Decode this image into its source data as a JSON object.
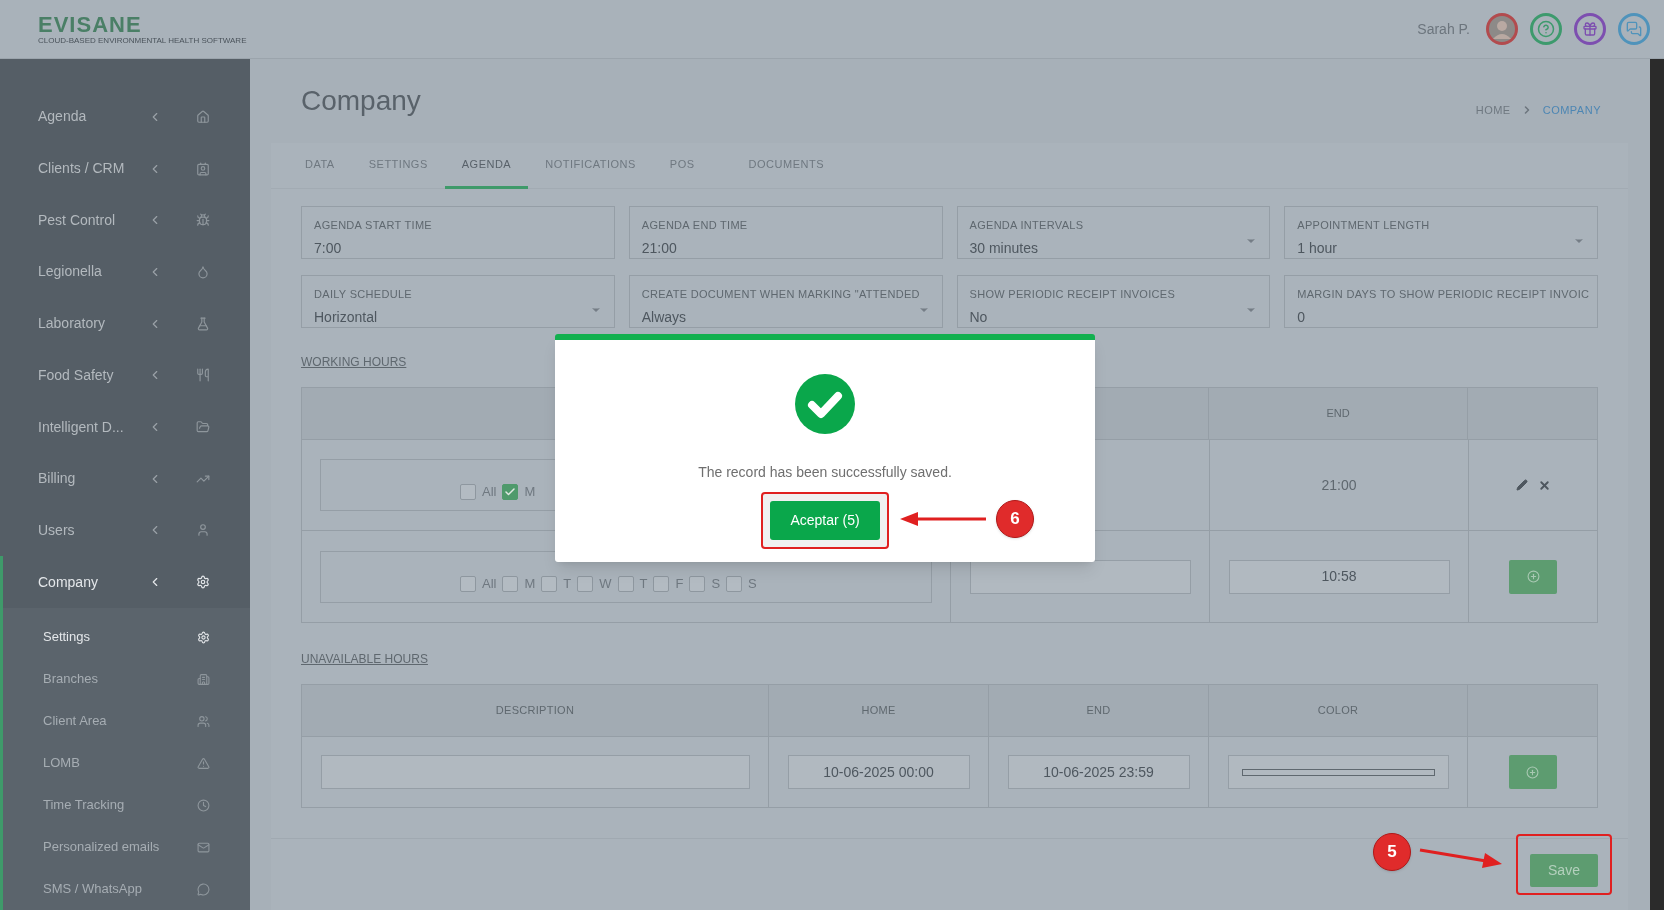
{
  "header": {
    "logo_name": "EVISANE",
    "logo_tagline": "CLOUD-BASED ENVIRONMENTAL HEALTH SOFTWARE",
    "user_name": "Sarah P."
  },
  "sidebar": {
    "items": [
      {
        "label": "Agenda",
        "selected": false
      },
      {
        "label": "Clients / CRM",
        "selected": false
      },
      {
        "label": "Pest Control",
        "selected": false
      },
      {
        "label": "Legionella",
        "selected": false
      },
      {
        "label": "Laboratory",
        "selected": false
      },
      {
        "label": "Food Safety",
        "selected": false
      },
      {
        "label": "Intelligent D...",
        "selected": false
      },
      {
        "label": "Billing",
        "selected": false
      },
      {
        "label": "Users",
        "selected": false
      },
      {
        "label": "Company",
        "selected": true,
        "expanded": true,
        "children": [
          {
            "label": "Settings",
            "selected": true
          },
          {
            "label": "Branches",
            "selected": false
          },
          {
            "label": "Client Area",
            "selected": false
          },
          {
            "label": "LOMB",
            "selected": false
          },
          {
            "label": "Time Tracking",
            "selected": false
          },
          {
            "label": "Personalized emails",
            "selected": false
          },
          {
            "label": "SMS / WhatsApp",
            "selected": false
          }
        ]
      }
    ]
  },
  "page": {
    "title": "Company",
    "breadcrumb": [
      {
        "label": "HOME",
        "selected": false
      },
      {
        "label": "COMPANY",
        "selected": true
      }
    ]
  },
  "tabs": [
    {
      "label": "DATA",
      "selected": false
    },
    {
      "label": "SETTINGS",
      "selected": false
    },
    {
      "label": "AGENDA",
      "selected": true
    },
    {
      "label": "NOTIFICATIONS",
      "selected": false
    },
    {
      "label": "POS",
      "selected": false
    },
    {
      "label": "DOCUMENTS",
      "selected": false
    }
  ],
  "fields": [
    {
      "label": "AGENDA START TIME",
      "value": "7:00",
      "kind": "text"
    },
    {
      "label": "AGENDA END TIME",
      "value": "21:00",
      "kind": "text"
    },
    {
      "label": "AGENDA INTERVALS",
      "value": "30 minutes",
      "kind": "select"
    },
    {
      "label": "APPOINTMENT LENGTH",
      "value": "1 hour",
      "kind": "select"
    },
    {
      "label": "DAILY SCHEDULE",
      "value": "Horizontal",
      "kind": "select"
    },
    {
      "label": "CREATE DOCUMENT WHEN MARKING \"ATTENDED",
      "value": "Always",
      "kind": "select"
    },
    {
      "label": "SHOW PERIODIC RECEIPT INVOICES",
      "value": "No",
      "kind": "select"
    },
    {
      "label": "MARGIN DAYS TO SHOW PERIODIC RECEIPT INVOIC",
      "value": "0",
      "kind": "text"
    }
  ],
  "working_hours": {
    "title": "WORKING HOURS",
    "end_header": "END",
    "rows": [
      {
        "kind": "saved",
        "days": [
          {
            "label": "All",
            "checked": false
          },
          {
            "label": "M",
            "checked": true
          }
        ],
        "end": "21:00"
      },
      {
        "kind": "new",
        "days": [
          {
            "label": "All",
            "checked": false
          },
          {
            "label": "M",
            "checked": false
          },
          {
            "label": "T",
            "checked": false
          },
          {
            "label": "W",
            "checked": false
          },
          {
            "label": "T",
            "checked": false
          },
          {
            "label": "F",
            "checked": false
          },
          {
            "label": "S",
            "checked": false
          },
          {
            "label": "S",
            "checked": false
          }
        ],
        "end": "10:58"
      }
    ]
  },
  "unavailable_hours": {
    "title": "UNAVAILABLE HOURS",
    "columns": [
      "DESCRIPTION",
      "HOME",
      "END",
      "COLOR"
    ],
    "row": {
      "home": "10-06-2025 00:00",
      "end": "10-06-2025 23:59"
    }
  },
  "save_button": "Save",
  "modal": {
    "message": "The record has been successfully saved.",
    "button": "Aceptar (5)"
  },
  "annotations": [
    {
      "label": "6"
    },
    {
      "label": "5"
    }
  ]
}
